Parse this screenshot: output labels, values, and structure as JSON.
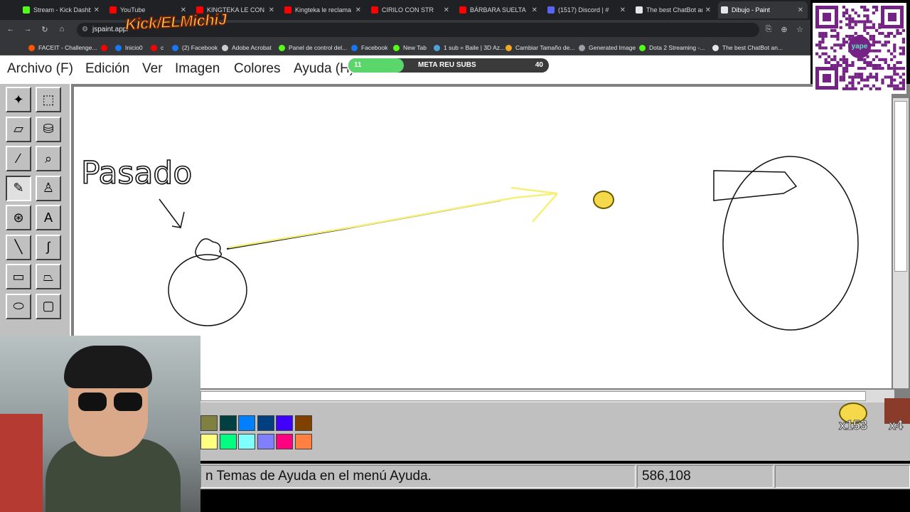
{
  "browser": {
    "tabs": [
      {
        "label": "Stream - Kick Dashbo",
        "color": "#53fc18"
      },
      {
        "label": "YouTube",
        "color": "#ff0000"
      },
      {
        "label": "KINGTEKA LE CON",
        "color": "#ff0000"
      },
      {
        "label": "Kingteka le reclama a",
        "color": "#ff0000"
      },
      {
        "label": "CIRILO CON STR",
        "color": "#ff0000"
      },
      {
        "label": "BÁRBARA SUELTA",
        "color": "#ff0000"
      },
      {
        "label": "(1517) Discord | #",
        "color": "#5865f2"
      },
      {
        "label": "The best ChatBot an",
        "color": "#e6e6e6"
      },
      {
        "label": "Dibujo - Paint",
        "color": "#e6e6e6"
      }
    ],
    "url": "jspaint.app/",
    "bookmarks": [
      {
        "label": "FACEIT - Challenge...",
        "color": "#ff5500"
      },
      {
        "label": "",
        "color": "#ff0000"
      },
      {
        "label": "Inicio0",
        "color": "#1877f2"
      },
      {
        "label": "c",
        "color": "#ff0000"
      },
      {
        "label": "(2) Facebook",
        "color": "#1877f2"
      },
      {
        "label": "Adobe Acrobat",
        "color": "#cccccc"
      },
      {
        "label": "Panel de control del...",
        "color": "#53fc18"
      },
      {
        "label": "Facebook",
        "color": "#1877f2"
      },
      {
        "label": "New Tab",
        "color": "#53fc18"
      },
      {
        "label": "1 sub = Baile | 3D Az...",
        "color": "#4aa3df"
      },
      {
        "label": "Cambiar Tamaño de...",
        "color": "#f5a623"
      },
      {
        "label": "Generated Image",
        "color": "#9aa0a6"
      },
      {
        "label": "Dota 2 Streaming -...",
        "color": "#53fc18"
      },
      {
        "label": "The best ChatBot an...",
        "color": "#e6e6e6"
      }
    ]
  },
  "paint": {
    "menus": [
      "Archivo (F)",
      "Edición",
      "Ver",
      "Imagen",
      "Colores",
      "Ayuda (H)"
    ],
    "tools": [
      {
        "icon": "free-select-icon"
      },
      {
        "icon": "rect-select-icon"
      },
      {
        "icon": "eraser-icon"
      },
      {
        "icon": "fill-bucket-icon"
      },
      {
        "icon": "color-picker-icon"
      },
      {
        "icon": "magnifier-icon"
      },
      {
        "icon": "pencil-icon"
      },
      {
        "icon": "brush-icon"
      },
      {
        "icon": "airbrush-icon"
      },
      {
        "icon": "text-icon"
      },
      {
        "icon": "line-icon"
      },
      {
        "icon": "curve-icon"
      },
      {
        "icon": "rectangle-icon"
      },
      {
        "icon": "polygon-icon"
      },
      {
        "icon": "ellipse-icon"
      },
      {
        "icon": "rounded-rect-icon"
      }
    ],
    "palette": {
      "top": [
        "#808040",
        "#004040",
        "#0080ff",
        "#004080",
        "#4000ff",
        "#804000"
      ],
      "bottom": [
        "#ffff80",
        "#00ff80",
        "#80ffff",
        "#8080ff",
        "#ff0080",
        "#ff8040"
      ]
    },
    "canvas_text": "Pasado",
    "status_help": "n Temas de Ayuda en el menú Ayuda.",
    "status_coords": "586,108"
  },
  "overlay": {
    "kick_logo": "Kick/ELMichiJ",
    "goal_label": "META REU SUBS",
    "goal_current": "11",
    "goal_target": "40",
    "qr_label": "yape",
    "emote1_count": "x153",
    "emote2_count": "x4"
  }
}
